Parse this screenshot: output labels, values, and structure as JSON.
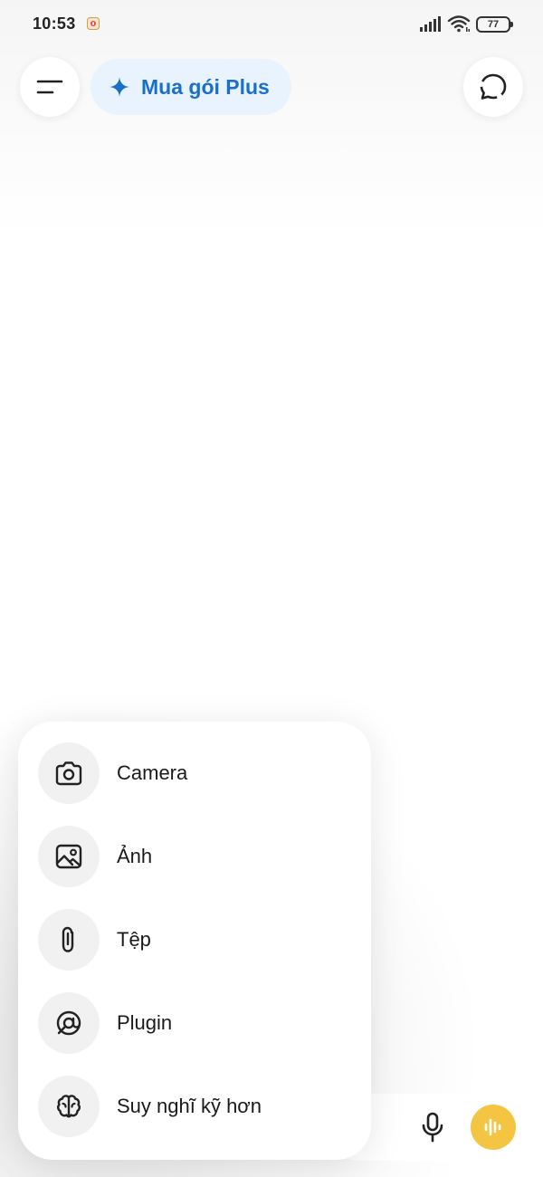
{
  "status_bar": {
    "time": "10:53",
    "battery": "77"
  },
  "header": {
    "plus_button_label": "Mua gói Plus",
    "menu_icon": "menu-lines-icon",
    "new_chat_icon": "new-chat-icon"
  },
  "attach_menu": {
    "items": [
      {
        "label": "Camera",
        "icon": "camera-icon"
      },
      {
        "label": "Ảnh",
        "icon": "image-icon"
      },
      {
        "label": "Tệp",
        "icon": "paperclip-icon"
      },
      {
        "label": "Plugin",
        "icon": "plugin-icon"
      },
      {
        "label": "Suy nghĩ kỹ hơn",
        "icon": "brain-icon"
      }
    ]
  },
  "composer": {
    "mic_icon": "microphone-icon",
    "voice_icon": "voice-waveform-icon"
  },
  "colors": {
    "plus_text": "#1a6fc9",
    "plus_bg": "#e9f3fd",
    "voice_button": "#f4c542"
  }
}
